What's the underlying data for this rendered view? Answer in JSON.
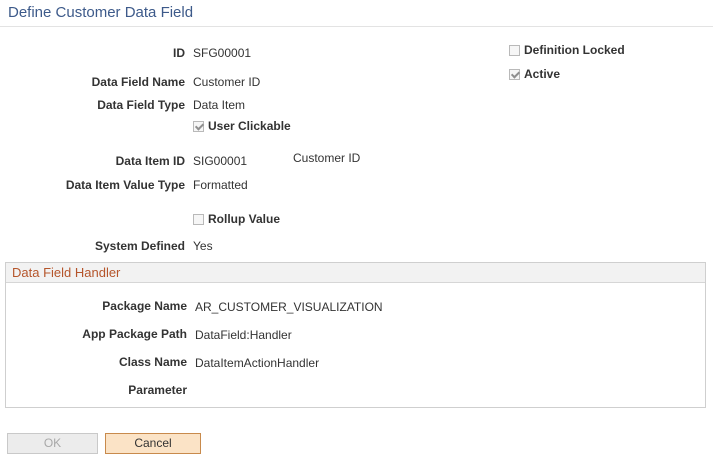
{
  "page": {
    "title": "Define Customer Data Field"
  },
  "fields": {
    "id": {
      "label": "ID",
      "value": "SFG00001"
    },
    "data_field_name": {
      "label": "Data Field Name",
      "value": "Customer ID"
    },
    "data_field_type": {
      "label": "Data Field Type",
      "value": "Data Item"
    },
    "user_clickable": {
      "label": "User Clickable",
      "checked": true
    },
    "data_item_id": {
      "label": "Data Item ID",
      "value": "SIG00001",
      "description": "Customer ID"
    },
    "data_item_value_type": {
      "label": "Data Item Value Type",
      "value": "Formatted"
    },
    "rollup_value": {
      "label": "Rollup Value",
      "checked": false
    },
    "system_defined": {
      "label": "System Defined",
      "value": "Yes"
    },
    "definition_locked": {
      "label": "Definition Locked",
      "checked": false
    },
    "active": {
      "label": "Active",
      "checked": true
    }
  },
  "handler": {
    "title": "Data Field Handler",
    "package_name": {
      "label": "Package Name",
      "value": "AR_CUSTOMER_VISUALIZATION"
    },
    "app_package_path": {
      "label": "App Package Path",
      "value": "DataField:Handler"
    },
    "class_name": {
      "label": "Class Name",
      "value": "DataItemActionHandler"
    },
    "parameter": {
      "label": "Parameter",
      "value": ""
    }
  },
  "buttons": {
    "ok": "OK",
    "cancel": "Cancel"
  }
}
